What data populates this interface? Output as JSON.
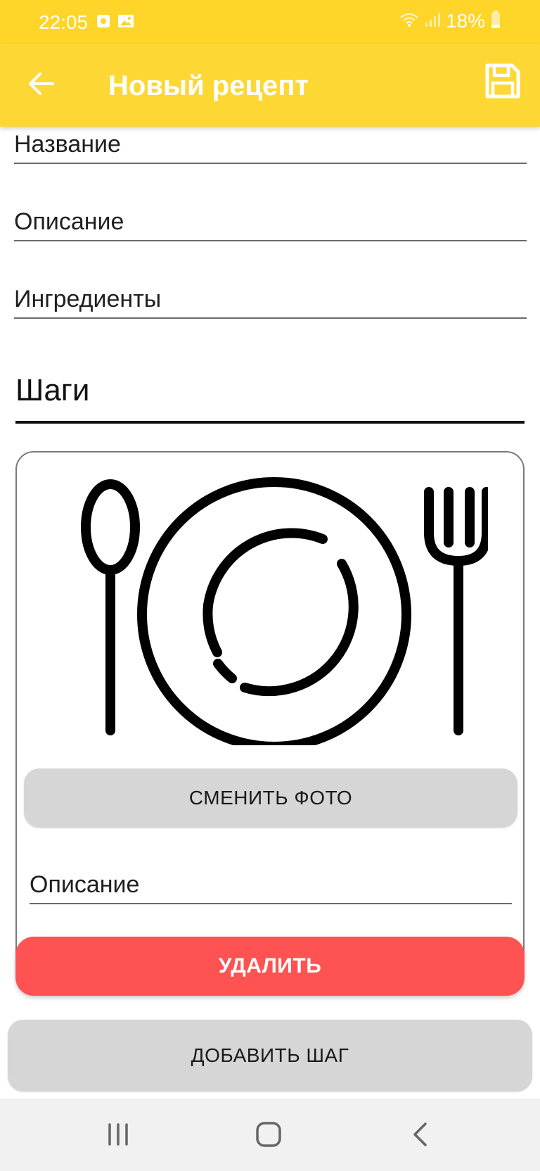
{
  "status_bar": {
    "time": "22:05",
    "battery": "18%"
  },
  "app_bar": {
    "title": "Новый рецепт",
    "back_icon": "arrow-left-icon",
    "save_icon": "save-floppy-icon"
  },
  "form": {
    "name_placeholder": "Название",
    "description_placeholder": "Описание",
    "ingredients_placeholder": "Ингредиенты"
  },
  "steps": {
    "heading": "Шаги",
    "card": {
      "photo_icon": "plate-cutlery-icon",
      "change_photo_label": "СМЕНИТЬ ФОТО",
      "description_placeholder": "Описание",
      "delete_label": "УДАЛИТЬ"
    },
    "add_step_label": "ДОБАВИТЬ ШАГ"
  },
  "nav_bar": {
    "recents_icon": "recents-icon",
    "home_icon": "home-icon",
    "back_icon": "back-chevron-icon"
  },
  "colors": {
    "app_bar": "#fdd835",
    "delete": "#ff5252",
    "button_gray": "#d6d6d6"
  }
}
